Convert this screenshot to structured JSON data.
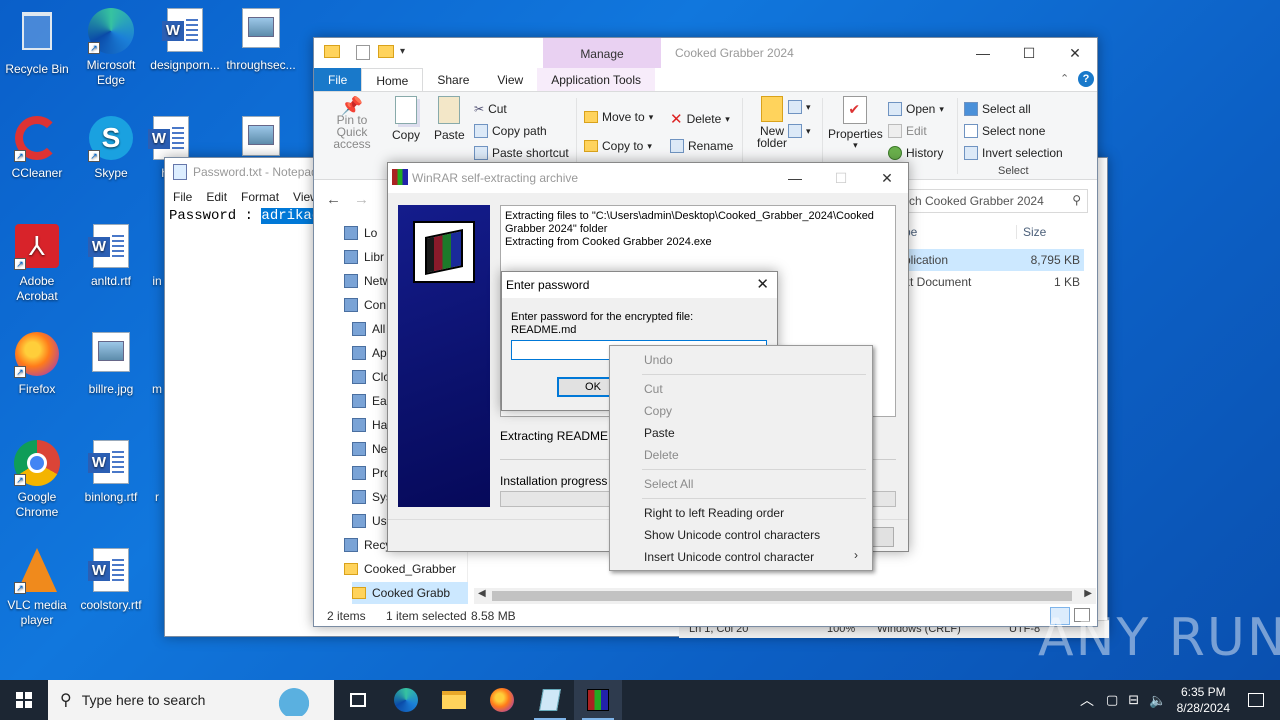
{
  "desktop_icons": [
    {
      "label": "Recycle Bin"
    },
    {
      "label": "Microsoft Edge"
    },
    {
      "label": "designporn..."
    },
    {
      "label": "throughsec..."
    },
    {
      "label": "CCleaner"
    },
    {
      "label": "Skype"
    },
    {
      "label": "ha"
    },
    {
      "label": "Adobe Acrobat"
    },
    {
      "label": "anltd.rtf"
    },
    {
      "label": "in"
    },
    {
      "label": "Firefox"
    },
    {
      "label": "billre.jpg"
    },
    {
      "label": "m"
    },
    {
      "label": "Google Chrome"
    },
    {
      "label": "binlong.rtf"
    },
    {
      "label": "r"
    },
    {
      "label": "VLC media player"
    },
    {
      "label": "coolstory.rtf"
    }
  ],
  "notepad": {
    "title": "Password.txt - Notepad",
    "menu": [
      "File",
      "Edit",
      "Format",
      "View"
    ],
    "text_prefix": "Password : ",
    "text_selected": "adrikad"
  },
  "explorer": {
    "title": "Cooked Grabber 2024",
    "manage_label": "Manage",
    "tabs": [
      "File",
      "Home",
      "Share",
      "View",
      "Application Tools"
    ],
    "ribbon": {
      "pin": "Pin to Quick access",
      "copy": "Copy",
      "paste": "Paste",
      "cut": "Cut",
      "copy_path": "Copy path",
      "paste_shortcut": "Paste shortcut",
      "move_to": "Move to",
      "copy_to": "Copy to",
      "delete": "Delete",
      "rename": "Rename",
      "new_folder": "New folder",
      "properties": "Properties",
      "open": "Open",
      "edit": "Edit",
      "history": "History",
      "select_all": "Select all",
      "select_none": "Select none",
      "invert_selection": "Invert selection",
      "group_select": "Select"
    },
    "search_placeholder": "rch Cooked Grabber 2024",
    "columns": [
      "pe",
      "Size"
    ],
    "rows": [
      {
        "type": "plication",
        "size": "8,795 KB",
        "selected": true
      },
      {
        "type": "xt Document",
        "size": "1 KB",
        "selected": false
      }
    ],
    "nav_items": [
      "Lo",
      "Libr",
      "Netw",
      "Con",
      "All",
      "Ap",
      "Clo",
      "Eas",
      "Ha",
      "Ne",
      "Pro",
      "Sys",
      "Us",
      "Recy",
      "Cooked_Grabber",
      "Cooked Grabb"
    ],
    "status_items": "2 items",
    "status_selected": "1 item selected",
    "status_size": "8.58 MB",
    "notepad_status": [
      "Ln 1, Col 20",
      "100%",
      "Windows (CRLF)",
      "UTF-8"
    ]
  },
  "winrar": {
    "title": "WinRAR self-extracting archive",
    "log_line1": "Extracting files to \"C:\\Users\\admin\\Desktop\\Cooked_Grabber_2024\\Cooked",
    "log_line2": "Grabber 2024\" folder",
    "log_line3": "Extracting from Cooked Grabber 2024.exe",
    "extracting": "Extracting README.md",
    "progress_label": "Installation progress",
    "progress": 0
  },
  "password_dialog": {
    "title": "Enter password",
    "prompt_line1": "Enter password for the encrypted file:",
    "prompt_line2": "README.md",
    "value": "",
    "ok_label": "OK"
  },
  "context_menu": [
    {
      "label": "Undo",
      "disabled": true
    },
    {
      "label": "Cut",
      "disabled": true
    },
    {
      "label": "Copy",
      "disabled": true
    },
    {
      "label": "Paste",
      "disabled": false
    },
    {
      "label": "Delete",
      "disabled": true
    },
    {
      "label": "Select All",
      "disabled": true
    },
    {
      "label": "Right to left Reading order",
      "disabled": false
    },
    {
      "label": "Show Unicode control characters",
      "disabled": false
    },
    {
      "label": "Insert Unicode control character",
      "disabled": false
    }
  ],
  "taskbar": {
    "search_placeholder": "Type here to search",
    "time": "6:35 PM",
    "date": "8/28/2024"
  },
  "watermark": "ANY RUN",
  "colors": {
    "accent": "#1979ca",
    "selection": "#cce8ff",
    "taskbar": "#1c2633"
  }
}
